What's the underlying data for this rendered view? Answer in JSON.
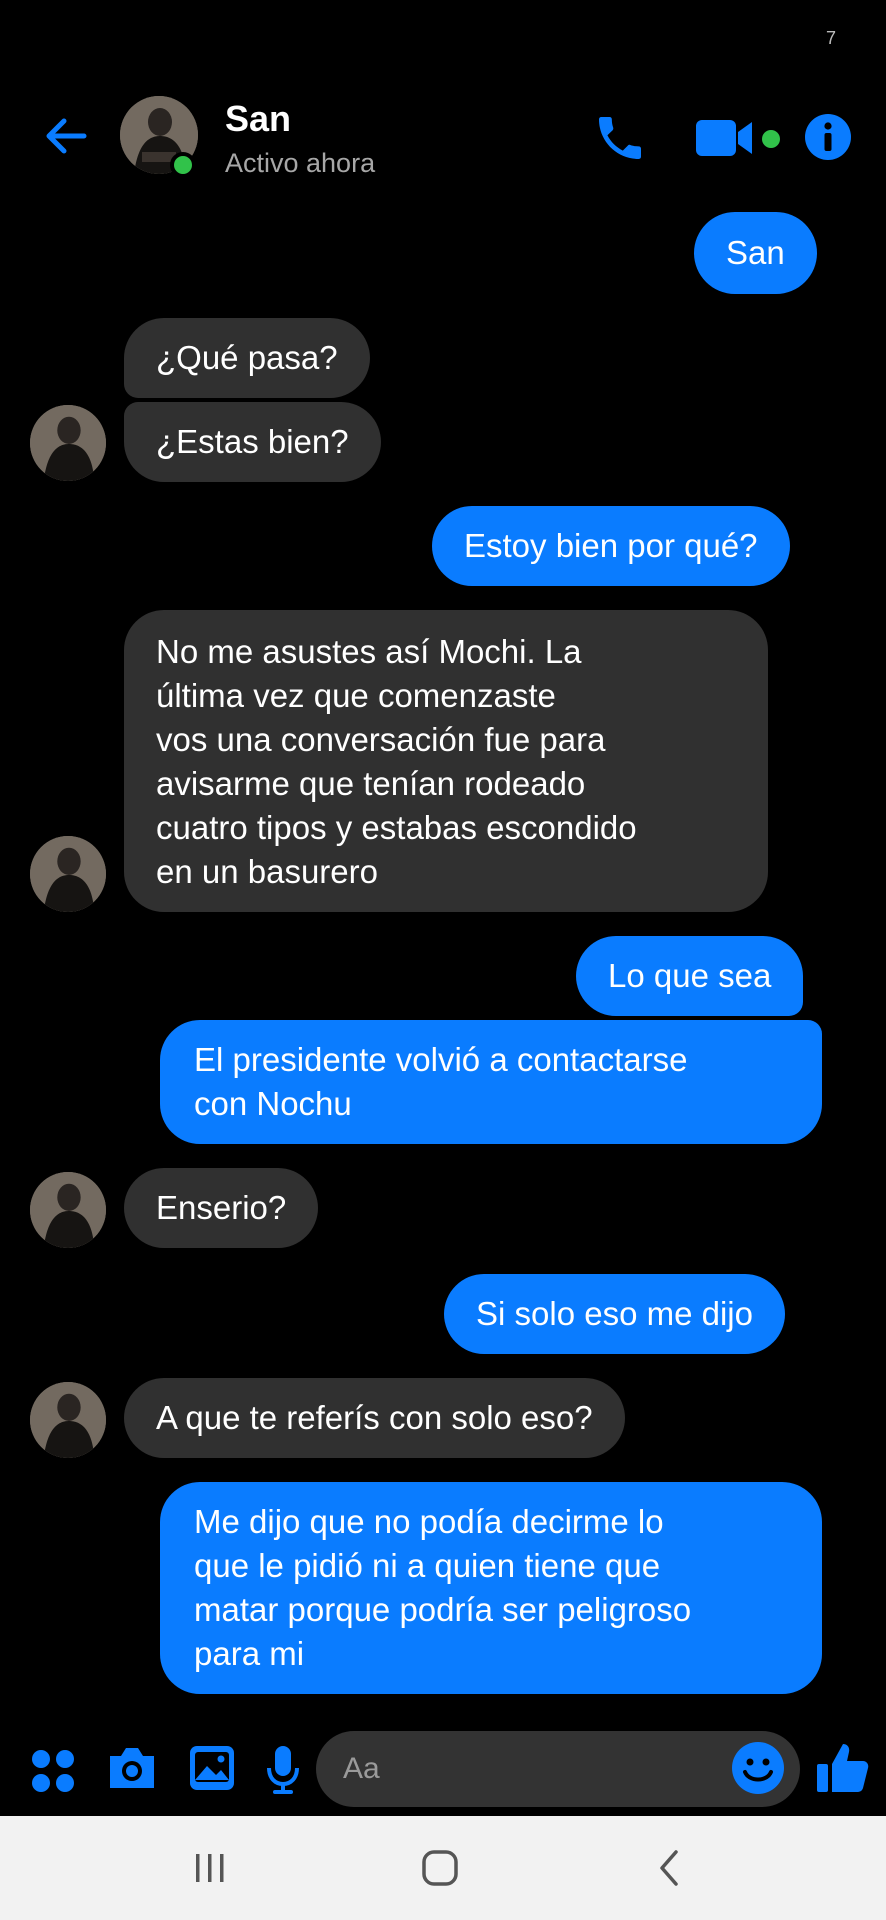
{
  "status_bar": {
    "glyph": "7"
  },
  "header": {
    "contact_name": "San",
    "contact_status": "Activo ahora",
    "icons": [
      "back-arrow-icon",
      "phone-icon",
      "video-camera-icon",
      "info-icon"
    ]
  },
  "messages": [
    {
      "from": "me",
      "text": "San"
    },
    {
      "from": "them",
      "text": "¿Qué pasa?"
    },
    {
      "from": "them",
      "text": "¿Estas bien?"
    },
    {
      "from": "me",
      "text": "Estoy bien por qué?"
    },
    {
      "from": "them",
      "text": "No me asustes así Mochi. La\núltima vez que comenzaste\nvos una conversación fue para\navisarme que tenían rodeado\ncuatro tipos y estabas escondido\nen un basurero"
    },
    {
      "from": "me",
      "text": "Lo que sea"
    },
    {
      "from": "me",
      "text": "El presidente volvió a contactarse\ncon Nochu"
    },
    {
      "from": "them",
      "text": "Enserio?"
    },
    {
      "from": "me",
      "text": "Si solo eso me dijo"
    },
    {
      "from": "them",
      "text": "A que te referís con solo eso?"
    },
    {
      "from": "me",
      "text": "Me dijo que no podía decirme lo\nque le pidió ni a quien tiene que\nmatar porque podría ser peligroso\npara mi"
    }
  ],
  "composer": {
    "placeholder": "Aa",
    "icons": [
      "apps-grid-icon",
      "camera-icon",
      "gallery-icon",
      "microphone-icon",
      "emoji-icon",
      "thumbs-up-icon"
    ]
  },
  "colors": {
    "accent": "#0a7cff",
    "incoming_bubble": "#303030",
    "background": "#000000",
    "online": "#31c24a"
  }
}
